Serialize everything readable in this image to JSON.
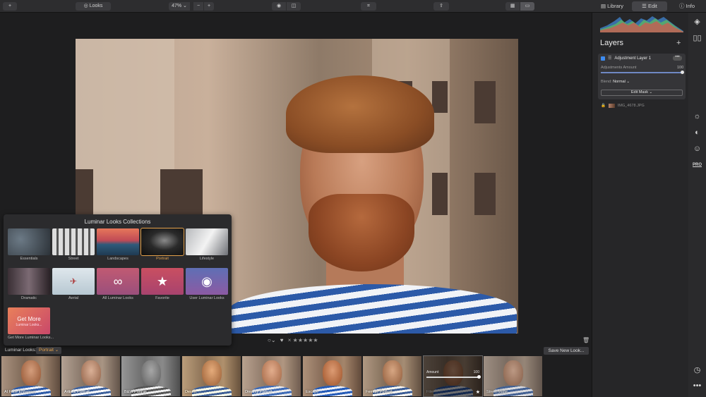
{
  "toolbar": {
    "looks_label": "Looks",
    "zoom": "47%",
    "zoom_minus": "−",
    "zoom_plus": "+",
    "tabs": [
      "Library",
      "Edit",
      "Info"
    ]
  },
  "looks_popup": {
    "title": "Luminar Looks Collections",
    "collections": [
      {
        "label": "Essentials"
      },
      {
        "label": "Street"
      },
      {
        "label": "Landscapes"
      },
      {
        "label": "Portrait"
      },
      {
        "label": "Lifestyle"
      },
      {
        "label": "Dramatic"
      },
      {
        "label": "Aerial"
      },
      {
        "label": "All Luminar Looks"
      },
      {
        "label": "Favorite"
      },
      {
        "label": "User Luminar Looks"
      }
    ],
    "get_more": {
      "title": "Get More",
      "subtitle": "Luminar Looks...",
      "label": "Get More Luminar Looks..."
    }
  },
  "looks_bar": {
    "label": "Luminar Looks:",
    "selected": "Portrait",
    "save_button": "Save New Look..."
  },
  "rating": {
    "reject": "×",
    "stars": "★★★★★"
  },
  "filmstrip": [
    {
      "label": "AI Face Enhancer"
    },
    {
      "label": "Artistic Portrait"
    },
    {
      "label": "B&W Portrait"
    },
    {
      "label": "Desert"
    },
    {
      "label": "Dreamy Portrait"
    },
    {
      "label": "Escape"
    },
    {
      "label": "Female Portrait"
    },
    {
      "label": "Film",
      "amount_label": "Amount",
      "amount_value": "100",
      "amount": 1.0
    },
    {
      "label": "Street Matte"
    }
  ],
  "layers": {
    "title": "Layers",
    "add": "+",
    "adjustment_layer": {
      "name": "Adjustment Layer 1",
      "more": "•••",
      "amount_label": "Adjustments Amount",
      "amount_value": "100",
      "amount": 1.0,
      "blend_label": "Blend:",
      "blend_value": "Normal ⌄",
      "mask_button": "Edit Mask ⌄"
    },
    "base_layer": {
      "name": "IMG_4678.JPG"
    }
  },
  "rail": {
    "pro_label": "PRO"
  },
  "colors": {
    "accent": "#e3a04a",
    "selection": "#3d8bf0"
  }
}
